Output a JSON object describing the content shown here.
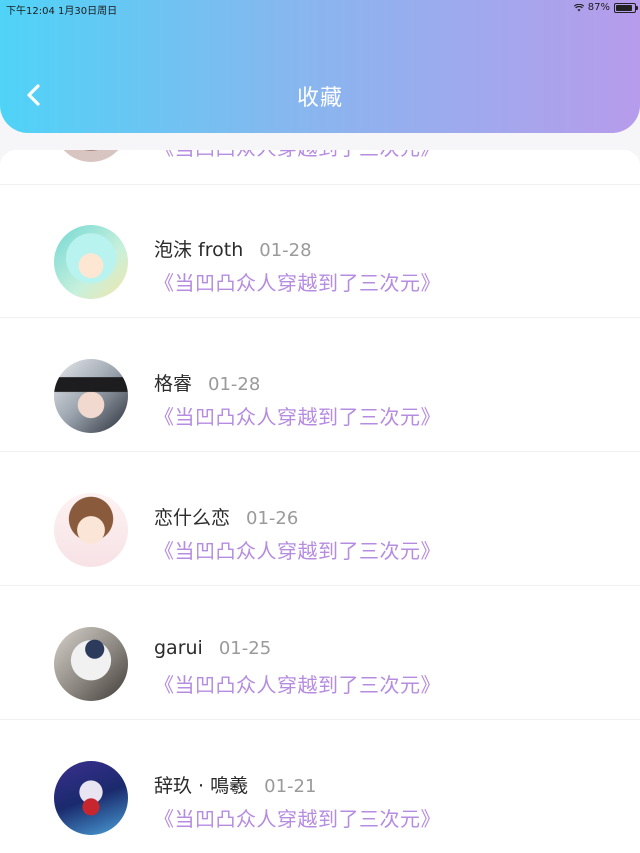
{
  "status_bar": {
    "time_date": "下午12:04   1月30日周日",
    "battery": "87%",
    "battery_level": 0.87
  },
  "header": {
    "title": "收藏",
    "back_icon": "chevron-left-icon"
  },
  "items": [
    {
      "name": "泡沫 froth",
      "date": "01-28",
      "novel": "《当凹凸众人穿越到了三次元》"
    },
    {
      "name": "格睿",
      "date": "01-28",
      "novel": "《当凹凸众人穿越到了三次元》"
    },
    {
      "name": "恋什么恋",
      "date": "01-26",
      "novel": "《当凹凸众人穿越到了三次元》"
    },
    {
      "name": "garui",
      "date": "01-25",
      "novel": "《当凹凸众人穿越到了三次元》"
    },
    {
      "name": "辞玖 · 鳴羲",
      "date": "01-21",
      "novel": "《当凹凸众人穿越到了三次元》"
    }
  ],
  "partial_item": {
    "novel": "《当凹凸众人穿越到了三次元》"
  },
  "colors": {
    "novel_link": "#b58ce0",
    "header_start": "#4fd3f7",
    "header_end": "#b79cec"
  }
}
